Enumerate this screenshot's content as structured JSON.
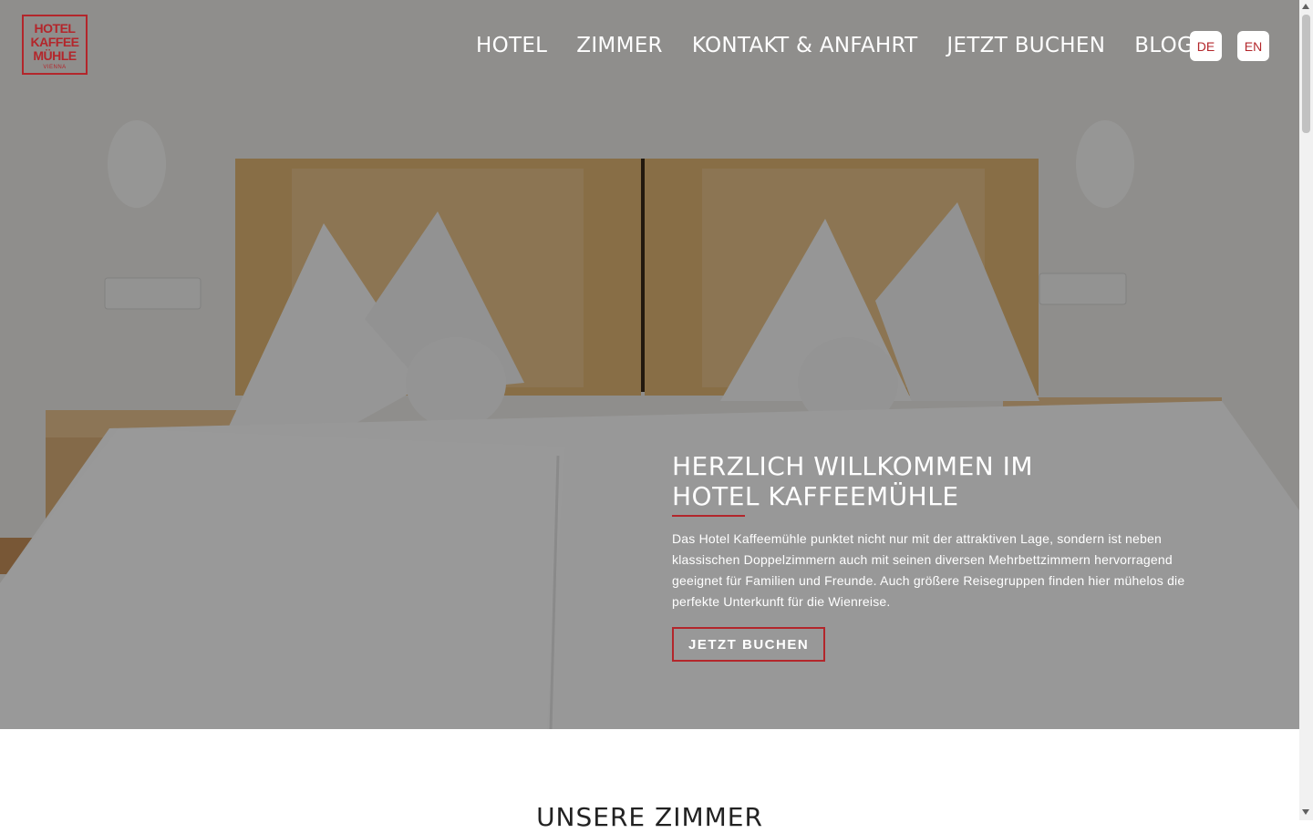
{
  "brand": {
    "logo_line1": "HOTEL",
    "logo_line2": "KAFFEE",
    "logo_line3": "MÜHLE",
    "logo_sub": "VIENNA",
    "accent_color": "#b3262b"
  },
  "nav": {
    "items": [
      {
        "label": "HOTEL"
      },
      {
        "label": "ZIMMER"
      },
      {
        "label": "KONTAKT & ANFAHRT"
      },
      {
        "label": "JETZT BUCHEN"
      },
      {
        "label": "BLOG"
      }
    ]
  },
  "language": {
    "de": "DE",
    "en": "EN"
  },
  "hero": {
    "heading_line1": "HERZLICH WILLKOMMEN IM",
    "heading_line2": "HOTEL KAFFEEMÜHLE",
    "text": "Das Hotel Kaffeemühle punktet nicht nur mit der attraktiven Lage, sondern ist neben klassischen Doppelzimmern auch mit seinen diversen Mehrbettzimmern hervorragend geeignet für Familien und Freunde. Auch größere Reisegruppen finden hier mühelos die perfekte Unterkunft für die Wienreise.",
    "cta_label": "JETZT BUCHEN"
  },
  "rooms_section": {
    "title": "UNSERE ZIMMER"
  }
}
